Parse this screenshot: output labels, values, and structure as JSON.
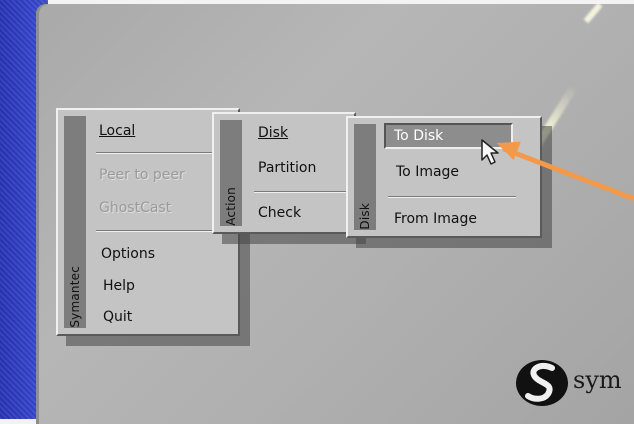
{
  "menus": {
    "main": {
      "sidebar_label": "Symantec",
      "items": [
        "Local",
        "Peer to peer",
        "GhostCast",
        "Options",
        "Help",
        "Quit"
      ]
    },
    "action": {
      "sidebar_label": "Action",
      "items": [
        "Disk",
        "Partition",
        "Check"
      ]
    },
    "disk": {
      "sidebar_label": "Disk",
      "items": [
        "To Disk",
        "To Image",
        "From Image"
      ]
    }
  },
  "colors": {
    "arrow": "#f39a4a",
    "menu_bg": "#c4c4c4",
    "screen_bg": "#b0b0b0"
  },
  "brand": {
    "logo_text": "sym"
  }
}
